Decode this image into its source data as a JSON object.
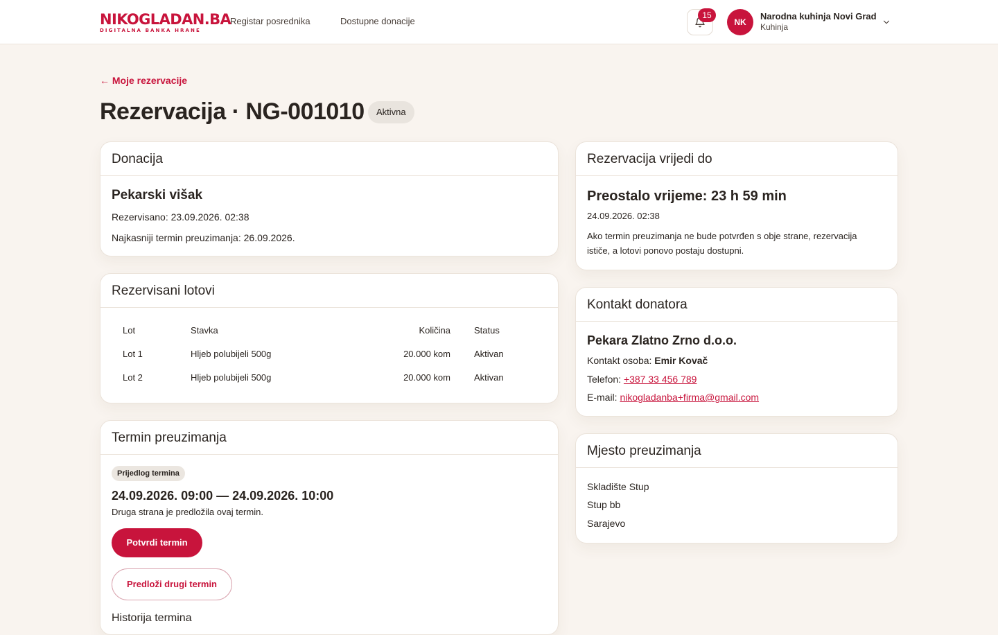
{
  "header": {
    "logo": {
      "main_a": "NIKO",
      "main_b": "GLADAN.BA",
      "sub": "DIGITALNA BANKA HRANE"
    },
    "nav": [
      "Registar posrednika",
      "Dostupne donacije"
    ],
    "notifications_count": "15",
    "user": {
      "initials": "NK",
      "name": "Narodna kuhinja Novi Grad",
      "role": "Kuhinja"
    }
  },
  "page": {
    "back_link": "← Moje rezervacije",
    "title": "Rezervacija · NG-001010",
    "status": "Aktivna"
  },
  "donation": {
    "heading": "Donacija",
    "name": "Pekarski višak",
    "reserved": "Rezervisano: 23.09.2026. 02:38",
    "latest_pickup": "Najkasniji termin preuzimanja: 26.09.2026."
  },
  "lots": {
    "heading": "Rezervisani lotovi",
    "columns": [
      "Lot",
      "Stavka",
      "Količina",
      "Status"
    ],
    "rows": [
      [
        "Lot 1",
        "Hljeb polubijeli 500g",
        "20.000 kom",
        "Aktivan"
      ],
      [
        "Lot 2",
        "Hljeb polubijeli 500g",
        "20.000 kom",
        "Aktivan"
      ]
    ]
  },
  "pickup_term": {
    "heading": "Termin preuzimanja",
    "badge": "Prijedlog termina",
    "range": "24.09.2026. 09:00 — 24.09.2026. 10:00",
    "note": "Druga strana je predložila ovaj termin.",
    "confirm_button": "Potvrdi termin",
    "propose_button": "Predloži drugi termin",
    "history_heading": "Historija termina"
  },
  "validity": {
    "heading": "Rezervacija vrijedi do",
    "remaining": "Preostalo vrijeme: 23 h 59 min",
    "until": "24.09.2026. 02:38",
    "note": "Ako termin preuzimanja ne bude potvrđen s obje strane, rezervacija ističe, a lotovi ponovo postaju dostupni."
  },
  "donor_contact": {
    "heading": "Kontakt donatora",
    "company": "Pekara Zlatno Zrno d.o.o.",
    "person_label": "Kontakt osoba: ",
    "person": "Emir Kovač",
    "phone_label": "Telefon: ",
    "phone": "+387 33 456 789",
    "email_label": "E-mail: ",
    "email": "nikogladanba+firma@gmail.com"
  },
  "pickup_place": {
    "heading": "Mjesto preuzimanja",
    "lines": [
      "Skladište Stup",
      "Stup bb",
      "Sarajevo"
    ]
  },
  "colors": {
    "brand": "#c8143c",
    "background": "#f9f4ef",
    "text": "#2a2420"
  },
  "icons": {
    "bell": "bell-icon",
    "chevron": "chevron-down-icon",
    "back": "arrow-left-icon"
  }
}
